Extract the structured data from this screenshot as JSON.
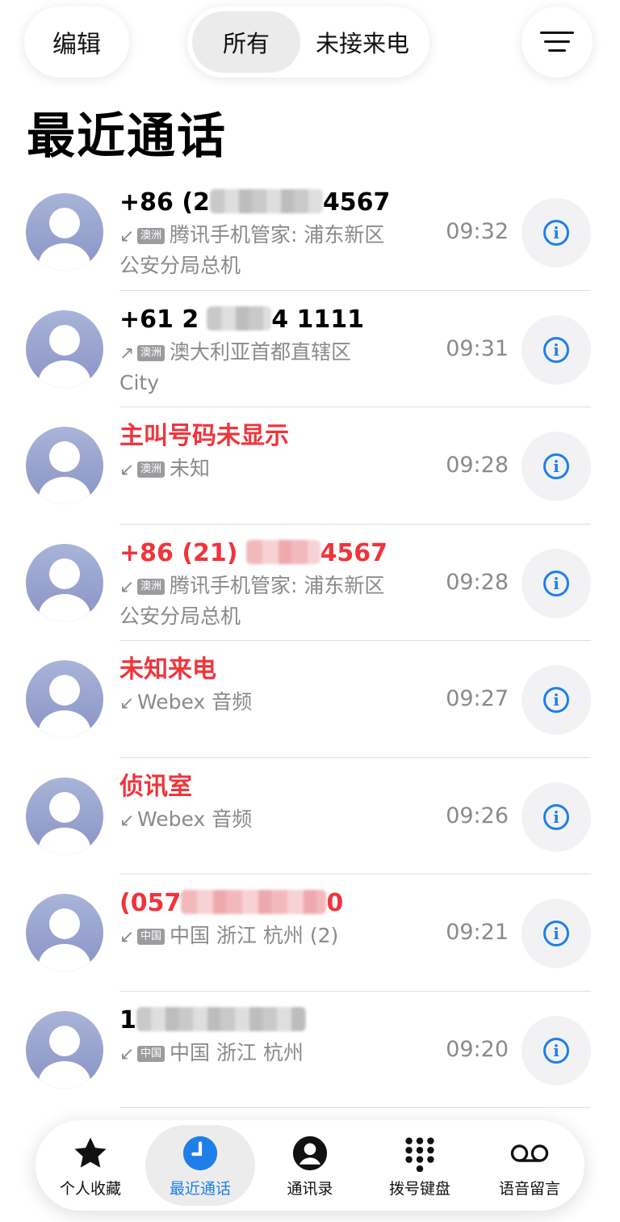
{
  "header": {
    "edit_label": "编辑",
    "segments": [
      {
        "label": "所有",
        "active": true
      },
      {
        "label": "未接来电",
        "active": false
      }
    ],
    "filter_icon": "filter-lines-icon"
  },
  "page_title": "最近通话",
  "calls": [
    {
      "name_prefix": "+86 (2",
      "name_suffix": "4567",
      "missed": false,
      "direction": "incoming",
      "tag": "澳洲",
      "location": "腾讯手机管家: 浦东新区公安分局总机",
      "time": "09:32"
    },
    {
      "name_prefix": "+61 2",
      "name_suffix": "4 1111",
      "missed": false,
      "direction": "outgoing",
      "tag": "澳洲",
      "location": "澳大利亚首都直辖区 City",
      "time": "09:31"
    },
    {
      "name_prefix": "主叫号码未显示",
      "name_suffix": "",
      "missed": true,
      "direction": "incoming",
      "tag": "澳洲",
      "location": "未知",
      "time": "09:28"
    },
    {
      "name_prefix": "+86 (21)",
      "name_suffix": "4567",
      "missed": true,
      "direction": "incoming",
      "tag": "澳洲",
      "location": "腾讯手机管家: 浦东新区公安分局总机",
      "time": "09:28"
    },
    {
      "name_prefix": "未知来电",
      "name_suffix": "",
      "missed": true,
      "direction": "incoming",
      "tag": "",
      "location": "Webex 音频",
      "time": "09:27"
    },
    {
      "name_prefix": "侦讯室",
      "name_suffix": "",
      "missed": true,
      "direction": "incoming",
      "tag": "",
      "location": "Webex 音频",
      "time": "09:26"
    },
    {
      "name_prefix": "(057",
      "name_suffix": "0",
      "missed": true,
      "direction": "incoming",
      "tag": "中国",
      "location": "中国 浙江 杭州 (2)",
      "time": "09:21"
    },
    {
      "name_prefix": "1",
      "name_suffix": "",
      "missed": false,
      "direction": "incoming",
      "tag": "中国",
      "location": "中国 浙江 杭州",
      "time": "09:20"
    }
  ],
  "arrows": {
    "incoming": "↙",
    "outgoing": "↗"
  },
  "info_glyph": "i",
  "tabbar": [
    {
      "label": "个人收藏",
      "icon": "star-icon",
      "active": false
    },
    {
      "label": "最近通话",
      "icon": "clock-icon",
      "active": true
    },
    {
      "label": "通讯录",
      "icon": "contact-icon",
      "active": false
    },
    {
      "label": "拨号键盘",
      "icon": "keypad-icon",
      "active": false
    },
    {
      "label": "语音留言",
      "icon": "voicemail-icon",
      "active": false
    }
  ],
  "colors": {
    "accent": "#1f7fe8",
    "missed": "#f0343c",
    "secondary": "#8a8a8e"
  }
}
